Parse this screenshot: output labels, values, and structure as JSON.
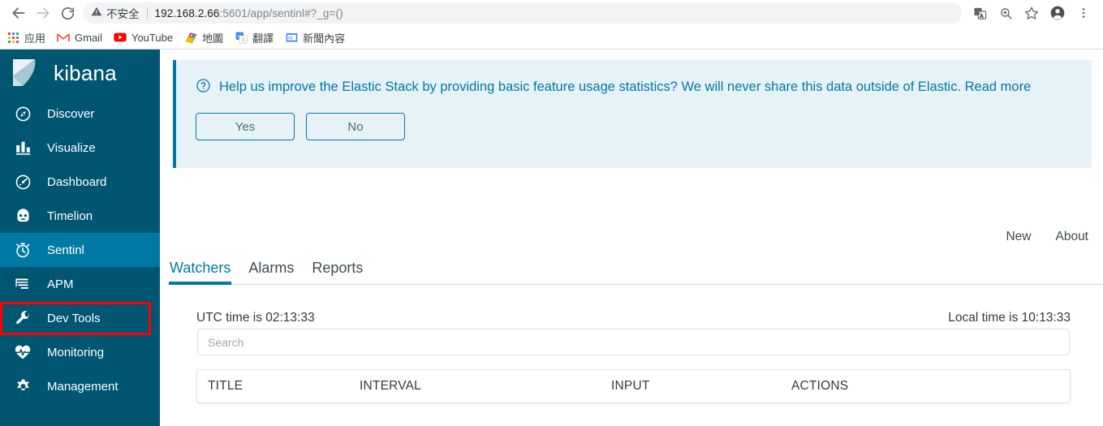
{
  "browser": {
    "back_icon": "back-arrow-icon",
    "forward_icon": "forward-arrow-icon",
    "reload_icon": "reload-icon",
    "security_label": "不安全",
    "url_host": "192.168.2.66",
    "url_path": ":5601/app/sentinl#?_g=()",
    "translate_icon": "translate-icon",
    "zoom_icon": "zoom-search-icon",
    "bookmark_icon": "star-icon",
    "profile_icon": "profile-avatar-icon",
    "menu_icon": "three-dot-menu-icon",
    "bookmarks": [
      {
        "label": "应用",
        "icon": "apps-grid-icon"
      },
      {
        "label": "Gmail",
        "icon": "gmail-icon"
      },
      {
        "label": "YouTube",
        "icon": "youtube-icon"
      },
      {
        "label": "地圖",
        "icon": "google-maps-icon"
      },
      {
        "label": "翻譯",
        "icon": "google-translate-icon"
      },
      {
        "label": "新聞內容",
        "icon": "google-news-icon"
      }
    ]
  },
  "sidebar": {
    "brand": "kibana",
    "brand_logo_icon": "kibana-logo-icon",
    "items": [
      {
        "label": "Discover",
        "icon": "compass-icon",
        "active": false
      },
      {
        "label": "Visualize",
        "icon": "bar-chart-icon",
        "active": false
      },
      {
        "label": "Dashboard",
        "icon": "gauge-icon",
        "active": false
      },
      {
        "label": "Timelion",
        "icon": "timelion-icon",
        "active": false
      },
      {
        "label": "Sentinl",
        "icon": "stopwatch-icon",
        "active": true
      },
      {
        "label": "APM",
        "icon": "apm-lines-icon",
        "active": false
      },
      {
        "label": "Dev Tools",
        "icon": "wrench-icon",
        "active": false
      },
      {
        "label": "Monitoring",
        "icon": "heart-pulse-icon",
        "active": false
      },
      {
        "label": "Management",
        "icon": "gear-icon",
        "active": false
      }
    ]
  },
  "banner": {
    "icon": "question-circle-icon",
    "message": "Help us improve the Elastic Stack by providing basic feature usage statistics? We will never share this data outside of Elastic. Read more",
    "yes_label": "Yes",
    "no_label": "No",
    "accent_color": "#0079a5",
    "background_color": "#e6f2f8"
  },
  "toplinks": {
    "new_label": "New",
    "about_label": "About"
  },
  "tabs": [
    {
      "label": "Watchers",
      "active": true
    },
    {
      "label": "Alarms",
      "active": false
    },
    {
      "label": "Reports",
      "active": false
    }
  ],
  "panel": {
    "utc_time": "UTC time is 02:13:33",
    "local_time": "Local time is 10:13:33",
    "search_placeholder": "Search",
    "search_value": "",
    "table": {
      "columns": [
        "TITLE",
        "INTERVAL",
        "INPUT",
        "ACTIONS"
      ],
      "rows": []
    }
  }
}
